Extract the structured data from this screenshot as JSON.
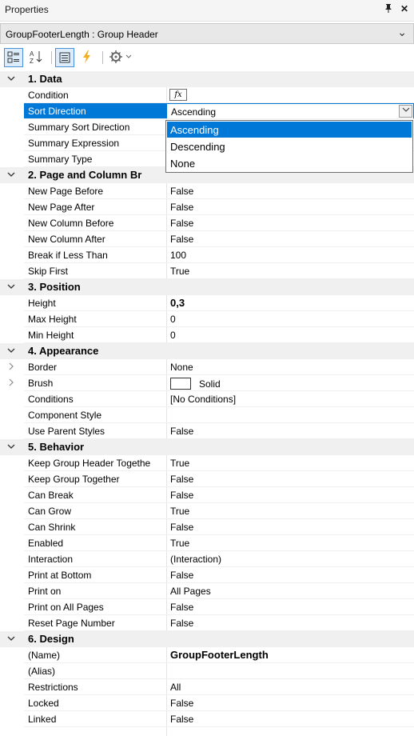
{
  "window": {
    "title": "Properties",
    "pin_icon": "pin-icon",
    "close_icon": "close-icon"
  },
  "object_selector": {
    "value": "GroupFooterLength : Group Header"
  },
  "toolbar": {
    "buttons": [
      "categorized-view-icon",
      "alphabetical-sort-icon",
      "properties-view-icon",
      "events-lightning-icon",
      "settings-gear-icon"
    ],
    "accent": "#0078d7"
  },
  "categories": [
    {
      "label": "1. Data",
      "rows": [
        {
          "name": "Condition",
          "value": "",
          "editor": "fx"
        },
        {
          "name": "Sort Direction",
          "value": "Ascending",
          "selected": true,
          "editor": "combo"
        },
        {
          "name": "Summary Sort Direction",
          "value": ""
        },
        {
          "name": "Summary Expression",
          "value": ""
        },
        {
          "name": "Summary Type",
          "value": ""
        }
      ]
    },
    {
      "label": "2. Page and  Column  Br",
      "rows": [
        {
          "name": "New Page Before",
          "value": "False"
        },
        {
          "name": "New Page After",
          "value": "False"
        },
        {
          "name": "New Column Before",
          "value": "False"
        },
        {
          "name": "New Column After",
          "value": "False"
        },
        {
          "name": "Break if Less Than",
          "value": "100"
        },
        {
          "name": "Skip First",
          "value": "True"
        }
      ]
    },
    {
      "label": "3. Position",
      "rows": [
        {
          "name": "Height",
          "value": "0,3",
          "bold": true
        },
        {
          "name": "Max Height",
          "value": "0"
        },
        {
          "name": "Min Height",
          "value": "0"
        }
      ]
    },
    {
      "label": "4. Appearance",
      "rows": [
        {
          "name": "Border",
          "value": "None",
          "expandable": true
        },
        {
          "name": "Brush",
          "value": "Solid",
          "expandable": true,
          "swatch": "#ffffff"
        },
        {
          "name": "Conditions",
          "value": "[No Conditions]"
        },
        {
          "name": "Component Style",
          "value": ""
        },
        {
          "name": "Use Parent Styles",
          "value": "False"
        }
      ]
    },
    {
      "label": "5. Behavior",
      "rows": [
        {
          "name": "Keep Group Header Togethe",
          "value": "True"
        },
        {
          "name": "Keep Group Together",
          "value": "False"
        },
        {
          "name": "Can Break",
          "value": "False"
        },
        {
          "name": "Can Grow",
          "value": "True"
        },
        {
          "name": "Can Shrink",
          "value": "False"
        },
        {
          "name": "Enabled",
          "value": "True"
        },
        {
          "name": "Interaction",
          "value": "(Interaction)"
        },
        {
          "name": "Print at Bottom",
          "value": "False"
        },
        {
          "name": "Print on",
          "value": "All Pages"
        },
        {
          "name": "Print on All Pages",
          "value": "False"
        },
        {
          "name": "Reset Page Number",
          "value": "False"
        }
      ]
    },
    {
      "label": "6. Design",
      "rows": [
        {
          "name": "(Name)",
          "value": "GroupFooterLength",
          "bold": true
        },
        {
          "name": "(Alias)",
          "value": ""
        },
        {
          "name": "Restrictions",
          "value": "All"
        },
        {
          "name": "Locked",
          "value": "False"
        },
        {
          "name": "Linked",
          "value": "False"
        }
      ]
    }
  ],
  "dropdown": {
    "options": [
      "Ascending",
      "Descending",
      "None"
    ],
    "highlighted": "Ascending"
  }
}
